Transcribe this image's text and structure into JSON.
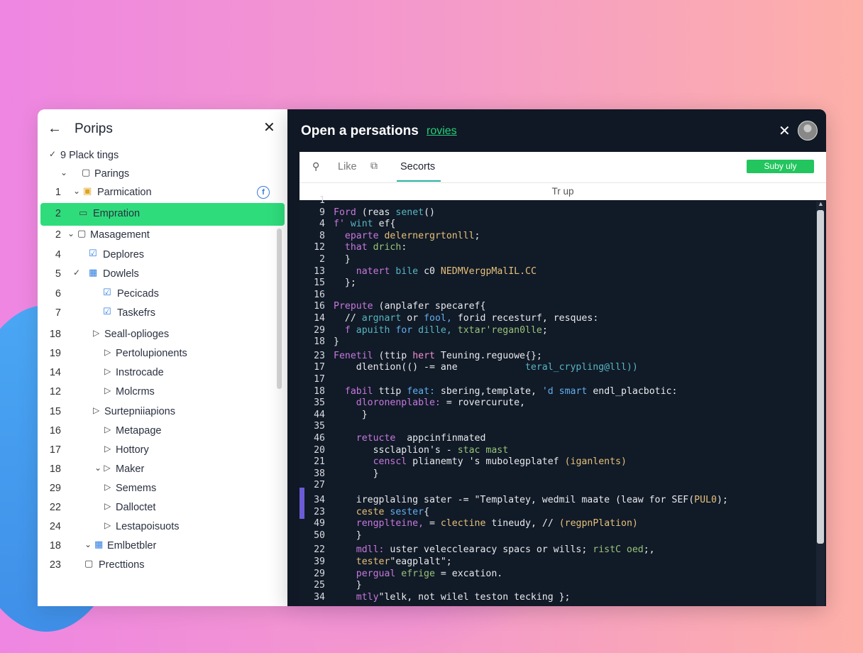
{
  "left_panel": {
    "title": "Porips",
    "back_icon": "arrow-left-icon",
    "close_icon": "close-icon",
    "tree": [
      {
        "num": "",
        "chev": "✓",
        "icon": "",
        "label": "9 Plack tings"
      },
      {
        "num": "",
        "chev": "⌄",
        "icon": "▢",
        "label": "Parings"
      },
      {
        "num": "1",
        "chev": "⌄",
        "icon": "▣",
        "label": "Parmication",
        "icon_color": "#e0a323"
      },
      {
        "num": "2",
        "chev": "",
        "icon": "▭",
        "label": "Empration",
        "active": true
      },
      {
        "num": "2",
        "chev": "⌄",
        "icon": "▢",
        "label": "Masagement"
      },
      {
        "num": "4",
        "chev": "",
        "icon": "☑",
        "label": "Deplores",
        "icon_color": "#2f7de1"
      },
      {
        "num": "5",
        "chev": "✓",
        "icon": "▦",
        "label": "Dowlels",
        "icon_color": "#2f7de1"
      },
      {
        "num": "6",
        "chev": "",
        "icon": "☑",
        "label": "Pecicads",
        "icon_color": "#2f7de1"
      },
      {
        "num": "7",
        "chev": "",
        "icon": "☑",
        "label": "Taskefrs",
        "icon_color": "#2f7de1"
      },
      {
        "num": "18",
        "chev": "▷",
        "icon": "",
        "label": "Seall-oplioges"
      },
      {
        "num": "19",
        "chev": "▷",
        "icon": "",
        "label": "Pertolupionents"
      },
      {
        "num": "14",
        "chev": "▷",
        "icon": "",
        "label": "Instrocade"
      },
      {
        "num": "12",
        "chev": "▷",
        "icon": "",
        "label": "Molcrms"
      },
      {
        "num": "15",
        "chev": "▷",
        "icon": "",
        "label": "Surtepniiapions"
      },
      {
        "num": "16",
        "chev": "▷",
        "icon": "",
        "label": "Metapage"
      },
      {
        "num": "17",
        "chev": "▷",
        "icon": "",
        "label": "Hottory"
      },
      {
        "num": "18",
        "chev": "⌄ ▷",
        "icon": "",
        "label": "Maker"
      },
      {
        "num": "29",
        "chev": "▷",
        "icon": "",
        "label": "Semems"
      },
      {
        "num": "22",
        "chev": "▷",
        "icon": "",
        "label": "Dalloctet"
      },
      {
        "num": "24",
        "chev": "▷",
        "icon": "",
        "label": "Lestapoisuots"
      },
      {
        "num": "18",
        "chev": "⌄",
        "icon": "▦",
        "label": "Emlbetbler",
        "icon_color": "#2f7de1"
      },
      {
        "num": "23",
        "chev": "",
        "icon": "▢",
        "label": "Precttions"
      }
    ]
  },
  "right_panel": {
    "title": "Open a persations",
    "link": "rovies",
    "toolbar": {
      "search_icon": "search-icon",
      "like_label": "Like",
      "copy_icon": "copy-icon",
      "active_tab": "Secorts",
      "button_label": "Suby uly"
    },
    "subtitle": "Tr up",
    "code_lines": [
      {
        "ln": "1",
        "html": ""
      },
      {
        "ln": "9",
        "html": "<span class='c-m'>Ford</span> <span class='c-w'>(reas</span> <span class='c-c'>senet</span><span class='c-w'>()</span>"
      },
      {
        "ln": "4",
        "html": "<span class='c-m'>f'</span> <span class='c-c'>wint</span> <span class='c-w'>ef{</span>"
      },
      {
        "ln": "8",
        "html": "  <span class='c-m'>eparte</span> <span class='c-y'>delernergrtonlll</span><span class='c-w'>;</span>"
      },
      {
        "ln": "12",
        "html": "  <span class='c-m'>that</span> <span class='c-g'>drich</span><span class='c-w'>:</span>"
      },
      {
        "ln": "2",
        "html": "  <span class='c-w'>}</span>"
      },
      {
        "ln": "13",
        "html": "    <span class='c-m'>natert</span> <span class='c-c'>bile</span> <span class='c-w'>c0</span> <span class='c-y'>NEDMVergpMalIL.CC</span>"
      },
      {
        "ln": "15",
        "html": "  <span class='c-w'>};</span>"
      },
      {
        "ln": "16",
        "html": ""
      },
      {
        "ln": "16",
        "html": "<span class='c-m'>Prepute</span> <span class='c-w'>(anplafer specaref{</span>"
      },
      {
        "ln": "14",
        "html": "  <span class='c-w'>//</span> <span class='c-c'>argnart</span> <span class='c-w'>or</span> <span class='c-b'>fool,</span> <span class='c-w'>forid recesturf, resques:</span>"
      },
      {
        "ln": "29",
        "html": "  <span class='c-m'>f</span> <span class='c-c'>apuith</span> <span class='c-b'>for</span> <span class='c-c'>dille,</span> <span class='c-g'>txtar'regan0lle</span><span class='c-w'>;</span>"
      },
      {
        "ln": "18",
        "html": "<span class='c-w'>}</span>"
      },
      {
        "ln": "23",
        "html": "<span class='c-m'>Fenetil</span> <span class='c-w'>(ttip</span> <span class='c-p'>hert</span> <span class='c-w'>Teuning.reguowe{};</span>"
      },
      {
        "ln": "17",
        "html": "    <span class='c-w'>dlention(() -= ane</span>            <span class='c-c'>teral_crypling@lll))</span>"
      },
      {
        "ln": "17",
        "html": ""
      },
      {
        "ln": "18",
        "html": "  <span class='c-m'>fabil</span> <span class='c-w'>ttip</span> <span class='c-b'>feat:</span> <span class='c-w'>sbering,template,</span> <span class='c-b'>'d smart</span> <span class='c-w'>endl_placbotic:</span>"
      },
      {
        "ln": "35",
        "html": "    <span class='c-m'>dloronenplable:</span> <span class='c-w'>= rovercurute,</span>"
      },
      {
        "ln": "44",
        "html": "     <span class='c-w'>}</span>"
      },
      {
        "ln": "35",
        "html": ""
      },
      {
        "ln": "46",
        "html": "    <span class='c-m'>retucte</span>  <span class='c-w'>appcinfinmated</span>"
      },
      {
        "ln": "20",
        "html": "       <span class='c-w'>ssclaplion's -</span> <span class='c-g'>stac mast</span>"
      },
      {
        "ln": "21",
        "html": "       <span class='c-m'>censcl</span> <span class='c-w'>plianemty 's mubolegplatef</span> <span class='c-y'>(iganlents)</span>"
      },
      {
        "ln": "38",
        "html": "       <span class='c-w'>}</span>"
      },
      {
        "ln": "27",
        "html": ""
      },
      {
        "ln": "34",
        "html": "    <span class='c-w'>iregplaling sater -= \"Templatey, wedmil maate (leaw for</span> <span class='c-w'>SEF(</span><span class='c-y'>PUL0</span><span class='c-w'>);</span>"
      },
      {
        "ln": "23",
        "html": "    <span class='c-y'>ceste</span> <span class='c-b'>sester</span><span class='c-w'>{</span>"
      },
      {
        "ln": "49",
        "html": "    <span class='c-m'>rengplteine,</span> <span class='c-w'>=</span> <span class='c-y'>clectine</span> <span class='c-w'>tineudy,</span> <span class='c-w'>//</span> <span class='c-y'>(regpnPlation)</span>"
      },
      {
        "ln": "50",
        "html": "    <span class='c-w'>}</span>"
      },
      {
        "ln": "22",
        "html": "    <span class='c-m'>mdll:</span> <span class='c-w'>uster velecclearacy spacs or wills;</span> <span class='c-g'>ristC oed</span><span class='c-w'>;,</span>"
      },
      {
        "ln": "39",
        "html": "    <span class='c-y'>tester</span><span class='c-w'>\"eagplalt\";</span>"
      },
      {
        "ln": "29",
        "html": "    <span class='c-m'>pergual</span> <span class='c-g'>efrige</span> <span class='c-w'>= excation.</span>"
      },
      {
        "ln": "25",
        "html": "    <span class='c-w'>}</span>"
      },
      {
        "ln": "34",
        "html": "    <span class='c-m'>mtly</span><span class='c-w'>\"lelk, not wilel teston tecking };</span>"
      }
    ]
  }
}
